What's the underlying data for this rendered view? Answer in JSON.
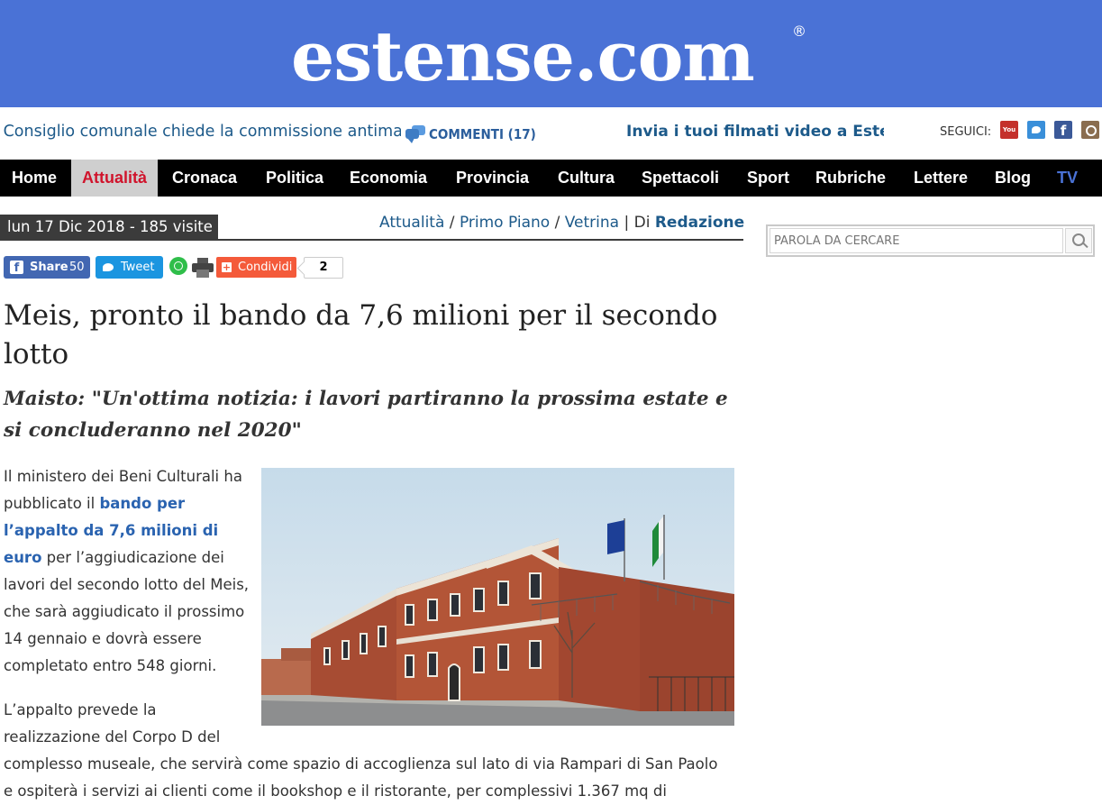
{
  "header": {
    "logo": "estense.com",
    "reg_mark": "®"
  },
  "ticker": {
    "headline": "Il Consiglio comunale chiede la commissione antimafia",
    "comments_label": "COMMENTI (17)",
    "promo": "Invia i tuoi filmati video a Estense",
    "follow_label": "SEGUICI:",
    "youtube_label": "You Tube",
    "facebook_label": "f"
  },
  "nav": {
    "items": [
      "Home",
      "Attualità",
      "Cronaca",
      "Politica",
      "Economia",
      "Provincia",
      "Cultura",
      "Spettacoli",
      "Sport",
      "Rubriche",
      "Lettere",
      "Blog",
      "TV"
    ],
    "active": "Attualità"
  },
  "meta": {
    "date_visits": "lun 17 Dic 2018 - 185 visite",
    "crumb_1": "Attualità",
    "crumb_2": "Primo Piano",
    "crumb_3": "Vetrina",
    "by": "Di",
    "author": "Redazione"
  },
  "share": {
    "fb_label": "Share",
    "fb_count": "50",
    "tw_label": "Tweet",
    "cond_label": "Condividi",
    "cond_count": "2"
  },
  "article": {
    "title": "Meis, pronto il bando da 7,6 milioni per il secondo lotto",
    "subtitle": "Maisto: \"Un'ottima notizia: i lavori partiranno la prossima estate e si concluderanno nel 2020\"",
    "p1_before": "Il ministero dei Beni Culturali ha pubblicato il ",
    "p1_link": "bando per l’appalto da 7,6 milioni di euro",
    "p1_after": " per l’aggiudicazione dei lavori del secondo lotto del Meis, che sarà aggiudicato il prossimo 14 gennaio e dovrà essere completato entro 548 giorni.",
    "p2_a": "L’appalto prevede la",
    "p2_b": "realizzazione del Corpo D del",
    "p2_c": "complesso museale, che servirà come spazio di accoglienza sul lato di via Rampari di San Paolo",
    "p2_d": "e ospiterà i servizi ai clienti come il bookshop e il ristorante, per complessivi 1.367 mq di"
  },
  "search": {
    "placeholder": "PAROLA DA CERCARE"
  },
  "colors": {
    "header_blue": "#4a72d6",
    "nav_bg": "#000000",
    "active_red": "#d0142c",
    "link_blue": "#1d5a8a"
  }
}
